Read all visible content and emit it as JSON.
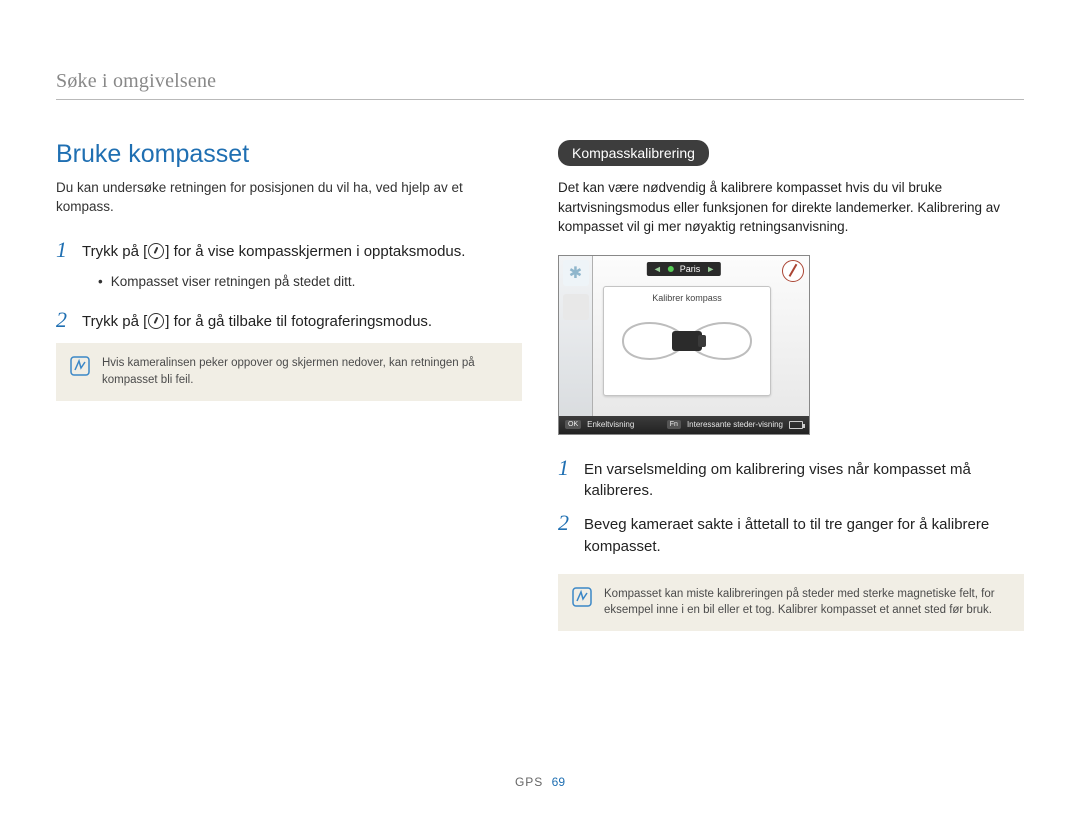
{
  "header": {
    "section_title": "Søke i omgivelsene"
  },
  "left": {
    "title": "Bruke kompasset",
    "intro": "Du kan undersøke retningen for posisjonen du vil ha, ved hjelp av et kompass.",
    "steps": [
      {
        "num": "1",
        "pre": "Trykk på [",
        "post": "] for å vise kompasskjermen i opptaksmodus.",
        "bullet": "Kompasset viser retningen på stedet ditt."
      },
      {
        "num": "2",
        "pre": "Trykk på [",
        "post": "] for å gå tilbake til fotograferingsmodus."
      }
    ],
    "note": "Hvis kameralinsen peker oppover og skjermen nedover, kan retningen på kompasset bli feil."
  },
  "right": {
    "pill": "Kompasskalibrering",
    "intro": "Det kan være nødvendig å kalibrere kompasset hvis du vil bruke kartvisningsmodus eller funksjonen for direkte landemerker. Kalibrering av kompasset vil gi mer nøyaktig retningsanvisning.",
    "screen": {
      "location_label": "Paris",
      "panel_title": "Kalibrer kompass",
      "bottom_left_key": "OK",
      "bottom_left_label": "Enkeltvisning",
      "bottom_right_key": "Fn",
      "bottom_right_label": "Interessante steder-visning"
    },
    "steps": [
      {
        "num": "1",
        "text": "En varselsmelding om kalibrering vises når kompasset må kalibreres."
      },
      {
        "num": "2",
        "text": "Beveg kameraet sakte i åttetall to til tre ganger for å kalibrere kompasset."
      }
    ],
    "note": "Kompasset kan miste kalibreringen på steder med sterke magnetiske felt, for eksempel inne i en bil eller et tog. Kalibrer kompasset et annet sted før bruk."
  },
  "footer": {
    "label": "GPS",
    "page": "69"
  }
}
